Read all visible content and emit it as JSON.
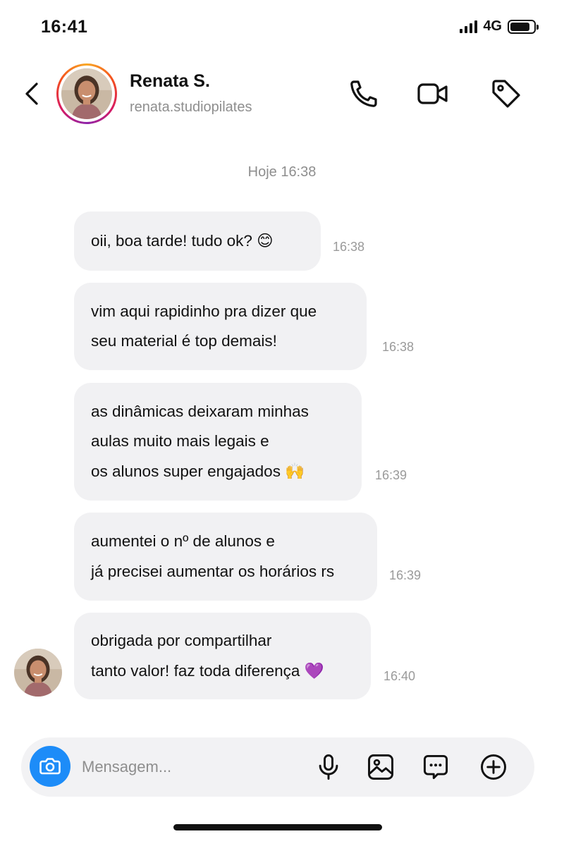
{
  "status_bar": {
    "time": "16:41",
    "network": "4G",
    "signal_icon": "cellular-signal-icon",
    "battery_icon": "battery-icon",
    "battery_level": 0.85
  },
  "header": {
    "name": "Renata S.",
    "handle": "renata.studiopilates",
    "icons": [
      "chevron-left-icon",
      "phone-icon",
      "video-camera-icon",
      "tag-icon"
    ]
  },
  "chat": {
    "date_label": "Hoje 16:38",
    "messages": [
      {
        "lines": [
          "oii, boa tarde! tudo ok? 😊"
        ],
        "time": "16:38"
      },
      {
        "lines": [
          "vim aqui rapidinho pra dizer que",
          "seu material é top demais!"
        ],
        "time": "16:38"
      },
      {
        "lines": [
          "as dinâmicas deixaram minhas",
          "aulas muito mais legais e",
          "os alunos super engajados 🙌"
        ],
        "time": "16:39"
      },
      {
        "lines": [
          "aumentei o nº de alunos e",
          "já precisei aumentar os horários rs"
        ],
        "time": "16:39"
      },
      {
        "lines": [
          "obrigada por compartilhar",
          "tanto valor! faz toda diferença 💜"
        ],
        "time": "16:40"
      }
    ]
  },
  "composer": {
    "placeholder": "Mensagem...",
    "value": "",
    "icons": [
      "camera-icon",
      "microphone-icon",
      "image-icon",
      "sticker-chat-icon",
      "plus-circle-icon"
    ]
  },
  "colors": {
    "accent": "#1d8cf8",
    "bubble": "#f1f1f3",
    "secondary_text": "#8e8e8e"
  }
}
